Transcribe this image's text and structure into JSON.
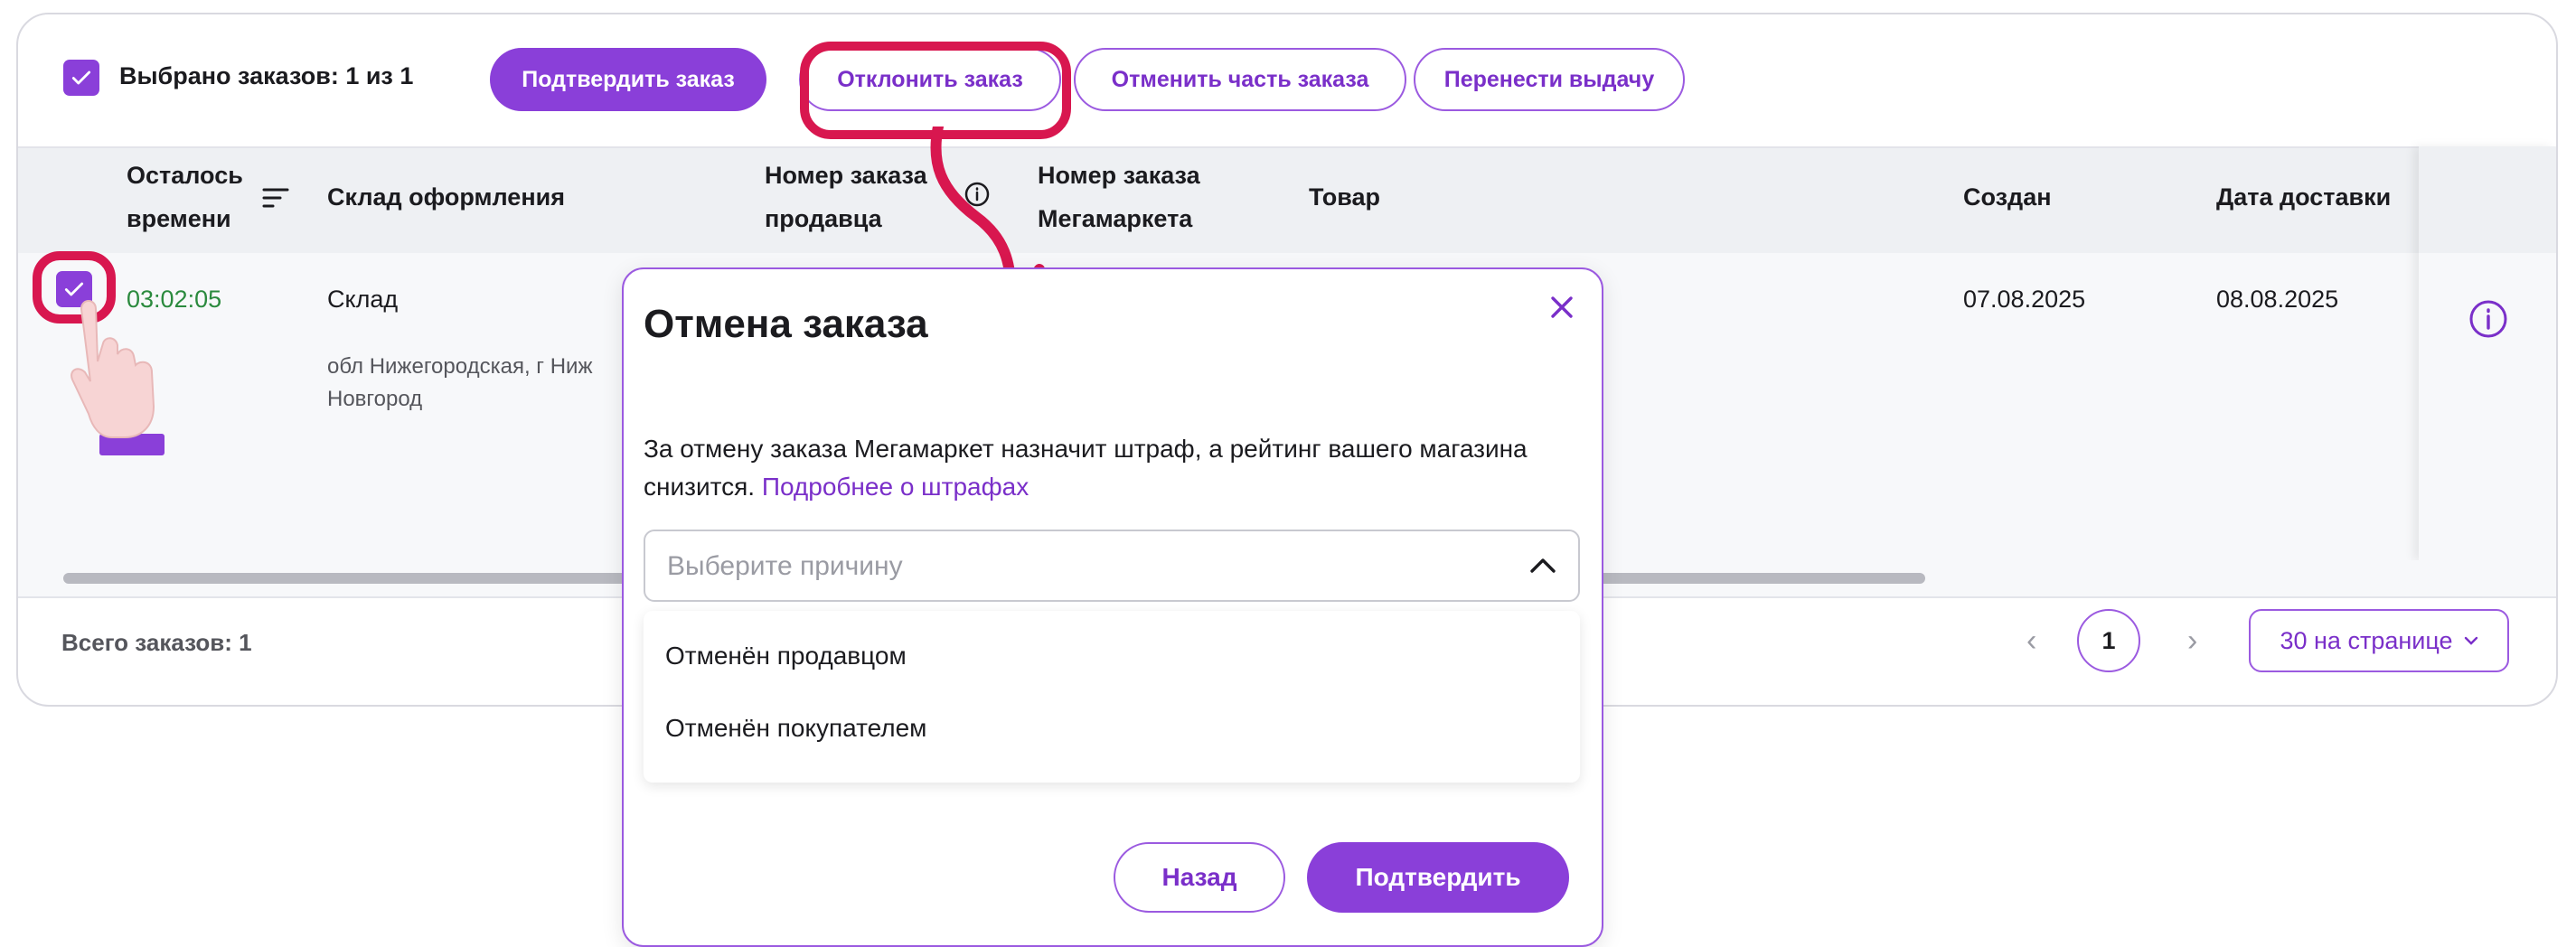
{
  "toolbar": {
    "selected_label": "Выбрано заказов: 1 из 1",
    "confirm_order": "Подтвердить заказ",
    "reject_order": "Отклонить заказ",
    "cancel_part": "Отменить часть заказа",
    "reschedule": "Перенести выдачу"
  },
  "table": {
    "headers": {
      "time_left_1": "Осталось",
      "time_left_2": "времени",
      "warehouse": "Склад оформления",
      "seller_no_1": "Номер заказа",
      "seller_no_2": "продавца",
      "mm_no_1": "Номер заказа",
      "mm_no_2": "Мегамаркета",
      "product": "Товар",
      "created": "Создан",
      "delivery": "Дата доставки"
    },
    "row": {
      "time_left": "03:02:05",
      "warehouse": "Склад",
      "address_1": "обл Нижегородская, г Ниж",
      "address_2": "Новгород",
      "created": "07.08.2025",
      "delivery": "08.08.2025"
    }
  },
  "footer": {
    "total": "Всего заказов: 1",
    "page": "1",
    "per_page": "30 на странице"
  },
  "modal": {
    "title": "Отмена заказа",
    "text": "За отмену заказа Мегамаркет назначит штраф, а рейтинг вашего магазина снизится.",
    "link": "Подробнее о штрафах",
    "select_placeholder": "Выберите причину",
    "options": [
      "Отменён продавцом",
      "Отменён покупателем"
    ],
    "back": "Назад",
    "confirm": "Подтвердить"
  },
  "colors": {
    "accent": "#8a3fd9",
    "highlight": "#d8174f",
    "timer": "#2b8a3e"
  }
}
